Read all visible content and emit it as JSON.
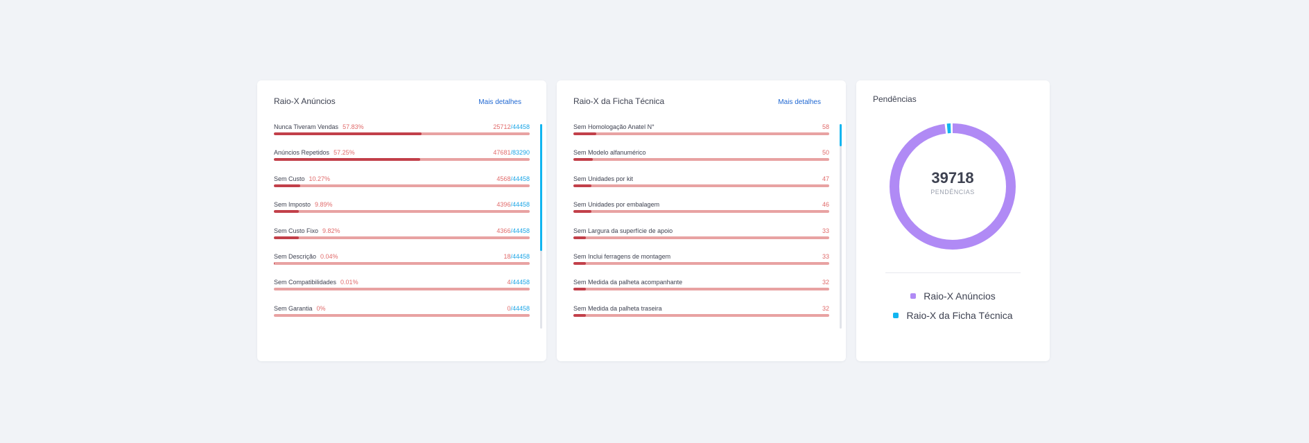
{
  "anuncios": {
    "title": "Raio-X Anúncios",
    "link": "Mais detalhes",
    "rows": [
      {
        "label": "Nunca Tiveram Vendas",
        "pct": "57.83%",
        "count": "25712",
        "sep": "/",
        "total": "44458",
        "fraction": 0.5783
      },
      {
        "label": "Anúncios Repetidos",
        "pct": "57.25%",
        "count": "47681",
        "sep": "/",
        "total": "83290",
        "fraction": 0.5725
      },
      {
        "label": "Sem Custo",
        "pct": "10.27%",
        "count": "4568",
        "sep": "/",
        "total": "44458",
        "fraction": 0.1027
      },
      {
        "label": "Sem Imposto",
        "pct": "9.89%",
        "count": "4396",
        "sep": "/",
        "total": "44458",
        "fraction": 0.0989
      },
      {
        "label": "Sem Custo Fixo",
        "pct": "9.82%",
        "count": "4366",
        "sep": "/",
        "total": "44458",
        "fraction": 0.0982
      },
      {
        "label": "Sem Descrição",
        "pct": "0.04%",
        "count": "18",
        "sep": "/",
        "total": "44458",
        "fraction": 0.0004
      },
      {
        "label": "Sem Compatibilidades",
        "pct": "0.01%",
        "count": "4",
        "sep": "/",
        "total": "44458",
        "fraction": 0.0001
      },
      {
        "label": "Sem Garantia",
        "pct": "0%",
        "count": "0",
        "sep": "/",
        "total": "44458",
        "fraction": 0
      }
    ],
    "scroll_position": 0.0,
    "scroll_visible_fraction": 0.62
  },
  "ficha": {
    "title": "Raio-X da Ficha Técnica",
    "link": "Mais detalhes",
    "rows": [
      {
        "label": "Sem Homologação Anatel N°",
        "count": "58",
        "fraction": 0.09
      },
      {
        "label": "Sem Modelo alfanumérico",
        "count": "50",
        "fraction": 0.075
      },
      {
        "label": "Sem Unidades por kit",
        "count": "47",
        "fraction": 0.07
      },
      {
        "label": "Sem Unidades por embalagem",
        "count": "46",
        "fraction": 0.07
      },
      {
        "label": "Sem Largura da superfície de apoio",
        "count": "33",
        "fraction": 0.05
      },
      {
        "label": "Sem Inclui ferragens de montagem",
        "count": "33",
        "fraction": 0.05
      },
      {
        "label": "Sem Medida da palheta acompanhante",
        "count": "32",
        "fraction": 0.05
      },
      {
        "label": "Sem Medida da palheta traseira",
        "count": "32",
        "fraction": 0.05
      }
    ],
    "scroll_position": 0.0,
    "scroll_visible_fraction": 0.11
  },
  "pendencias": {
    "title": "Pendências",
    "total": "39718",
    "total_label": "PENDÊNCIAS",
    "segments": [
      {
        "name": "Raio-X Anúncios",
        "color": "#b08af5",
        "share": 0.985
      },
      {
        "name": "Raio-X da Ficha Técnica",
        "color": "#11b5f0",
        "share": 0.015
      }
    ],
    "legend": [
      {
        "name": "Raio-X Anúncios",
        "color": "#b08af5"
      },
      {
        "name": "Raio-X da Ficha Técnica",
        "color": "#11b5f0"
      }
    ]
  }
}
